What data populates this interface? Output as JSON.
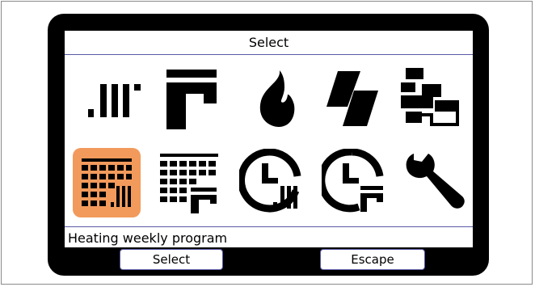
{
  "screen": {
    "title": "Select",
    "status_text": "Heating weekly program"
  },
  "menu": {
    "selected_icon": "heating-weekly-program-icon",
    "selected_color": "#f29a5c",
    "icons": [
      "radiator-icon",
      "tap-water-icon",
      "flame-icon",
      "solar-panel-icon",
      "network-icon",
      "heating-weekly-program-icon",
      "water-weekly-program-icon",
      "heating-clock-icon",
      "water-clock-icon",
      "wrench-icon"
    ]
  },
  "softkeys": {
    "left_label": "Select",
    "right_label": "Escape"
  }
}
